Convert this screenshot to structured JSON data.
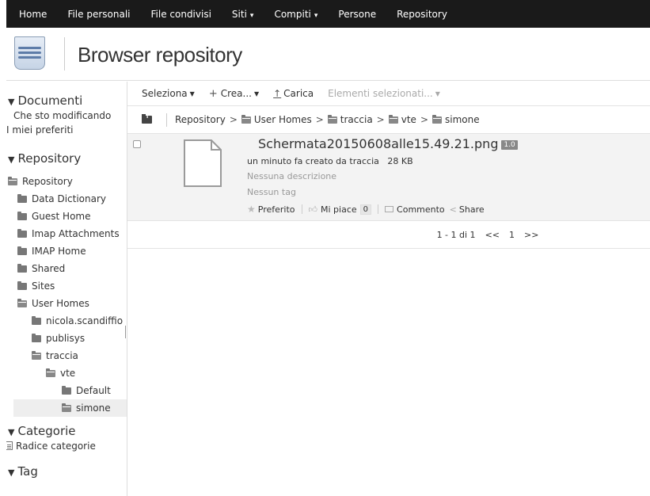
{
  "topnav": {
    "items": [
      {
        "label": "Home",
        "dropdown": false
      },
      {
        "label": "File personali",
        "dropdown": false
      },
      {
        "label": "File condivisi",
        "dropdown": false
      },
      {
        "label": "Siti",
        "dropdown": true
      },
      {
        "label": "Compiti",
        "dropdown": true
      },
      {
        "label": "Persone",
        "dropdown": false
      },
      {
        "label": "Repository",
        "dropdown": false
      }
    ]
  },
  "header": {
    "title": "Browser repository"
  },
  "sidebar": {
    "documenti": {
      "heading": "Documenti",
      "links": [
        "Che sto modificando",
        "I miei preferiti"
      ]
    },
    "repository": {
      "heading": "Repository",
      "tree": [
        {
          "label": "Repository",
          "depth": 0,
          "open": true
        },
        {
          "label": "Data Dictionary",
          "depth": 1
        },
        {
          "label": "Guest Home",
          "depth": 1
        },
        {
          "label": "Imap Attachments",
          "depth": 1
        },
        {
          "label": "IMAP Home",
          "depth": 1
        },
        {
          "label": "Shared",
          "depth": 1
        },
        {
          "label": "Sites",
          "depth": 1
        },
        {
          "label": "User Homes",
          "depth": 1,
          "open": true
        },
        {
          "label": "nicola.scandiffio",
          "depth": 2
        },
        {
          "label": "publisys",
          "depth": 2
        },
        {
          "label": "traccia",
          "depth": 2,
          "open": true
        },
        {
          "label": "vte",
          "depth": 3,
          "open": true
        },
        {
          "label": "Default",
          "depth": 4
        },
        {
          "label": "simone",
          "depth": 4,
          "open": true,
          "selected": true
        }
      ]
    },
    "categorie": {
      "heading": "Categorie",
      "root": "Radice categorie"
    },
    "tag": {
      "heading": "Tag"
    }
  },
  "toolbar": {
    "select": "Seleziona",
    "create": "Crea...",
    "upload": "Carica",
    "selected_items": "Elementi selezionati..."
  },
  "breadcrumb": [
    "Repository",
    "User Homes",
    "traccia",
    "vte",
    "simone"
  ],
  "file": {
    "name": "Schermata20150608alle15.49.21.png",
    "version": "1.0",
    "modified": "un minuto fa creato da traccia",
    "size": "28 KB",
    "description": "Nessuna descrizione",
    "tags": "Nessun tag",
    "favorite": "Preferito",
    "like": "Mi piace",
    "like_count": "0",
    "comment": "Commento",
    "share": "Share"
  },
  "pagination": {
    "summary": "1 - 1 di 1",
    "prev": "<<",
    "page": "1",
    "next": ">>"
  },
  "colors": {
    "topbar": "#1a1a1a",
    "row_highlight": "#f3f3f3",
    "selected_tree": "#eeeeee",
    "version_badge": "#888888"
  }
}
